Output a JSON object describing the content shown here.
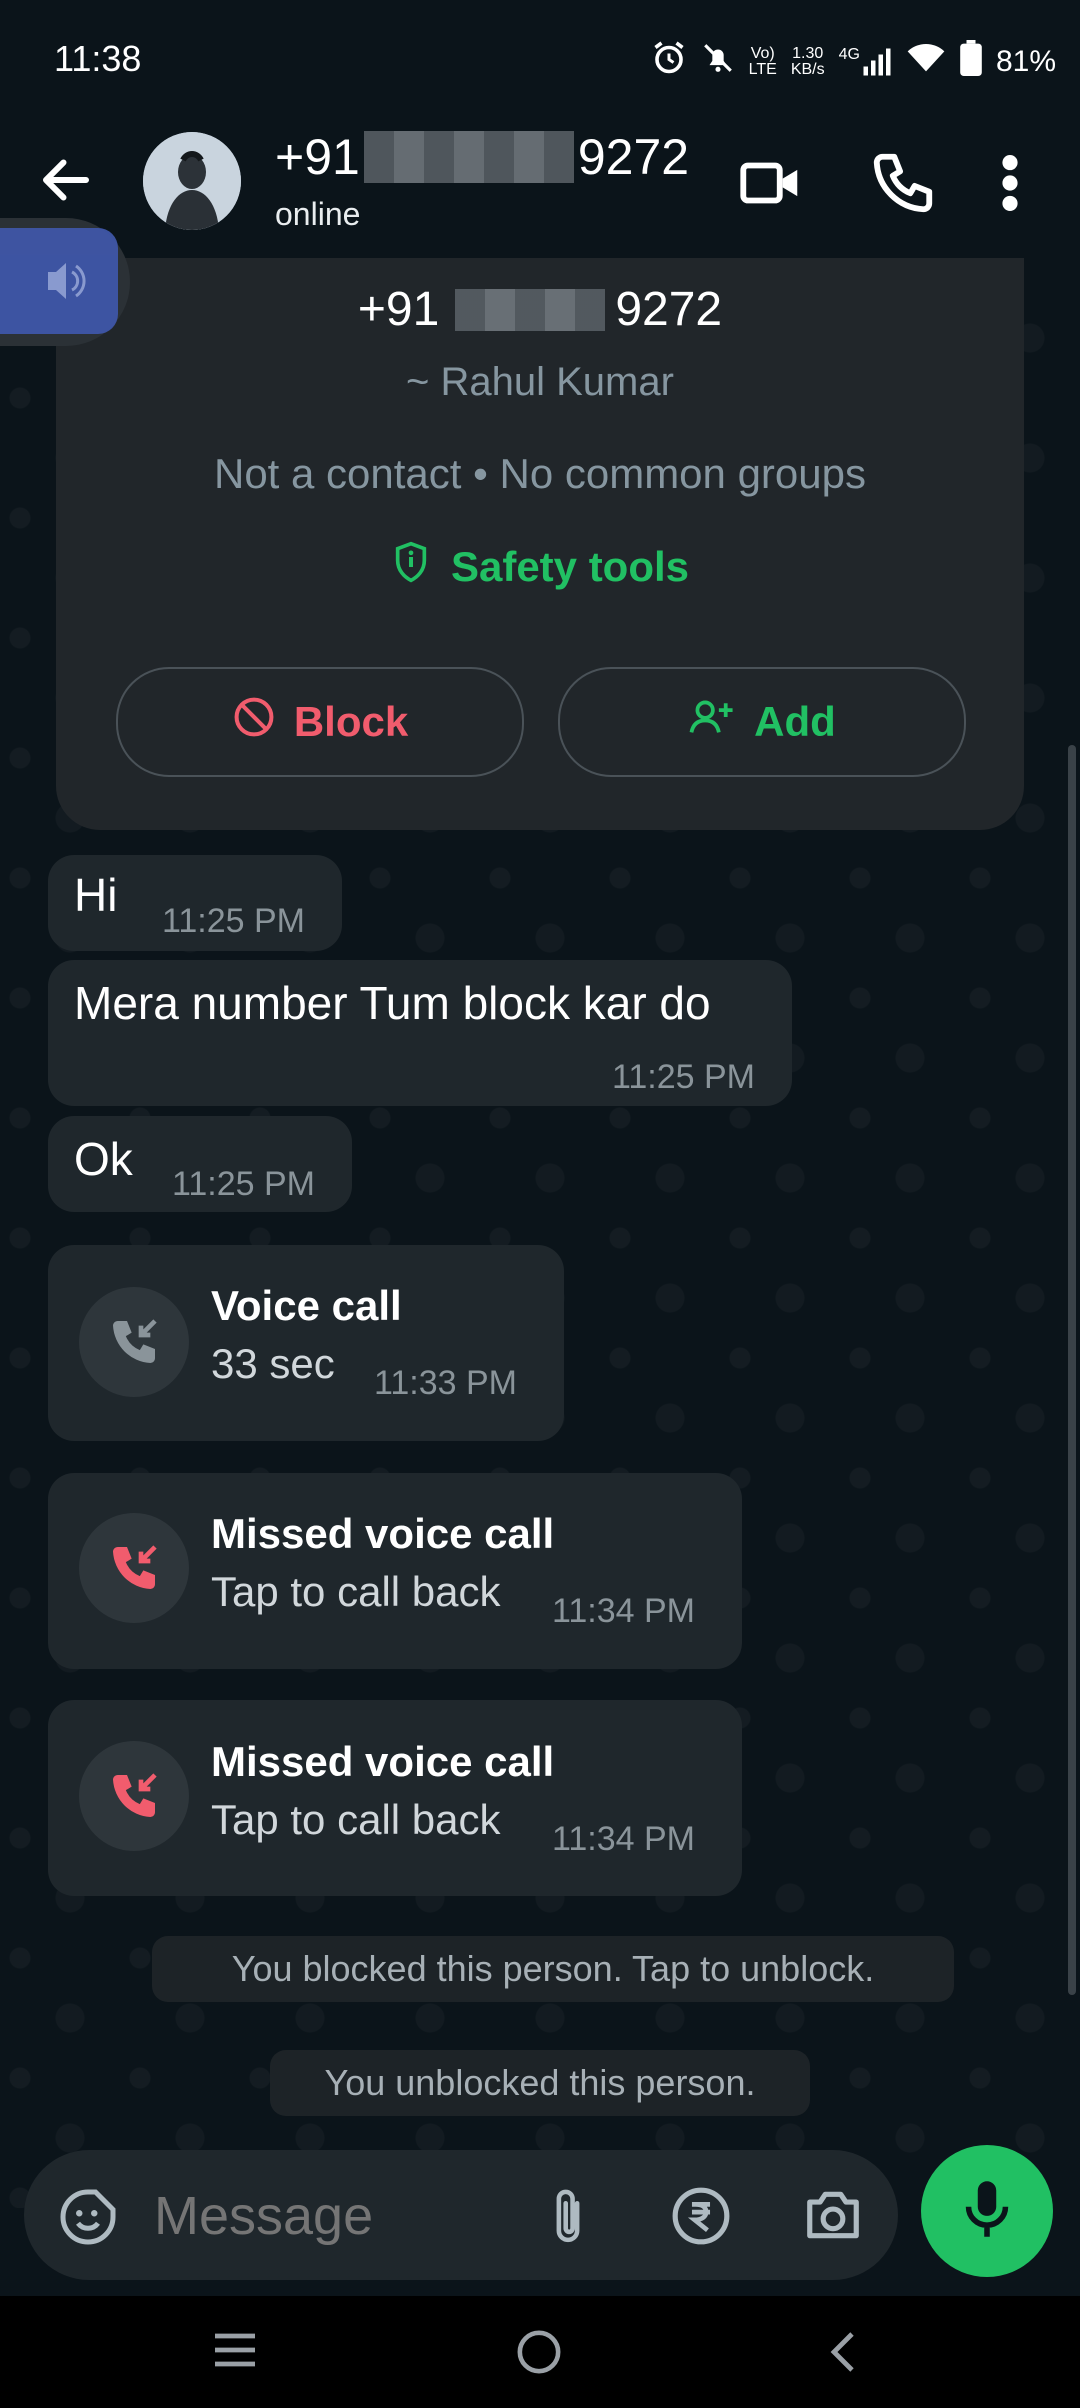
{
  "status_bar": {
    "time": "11:38",
    "net_speed": "1.30",
    "net_speed_unit": "KB/s",
    "volte": "Vo)",
    "lte": "LTE",
    "network": "4G",
    "battery": "81%"
  },
  "header": {
    "name_prefix": "+91",
    "name_suffix": "9272",
    "status": "online"
  },
  "card": {
    "number_prefix": "+91",
    "number_suffix": "9272",
    "display_name": "~ Rahul Kumar",
    "info": "Not a contact • No common groups",
    "safety_tools": "Safety tools",
    "block_label": "Block",
    "add_label": "Add"
  },
  "messages": [
    {
      "text": "Hi",
      "time": "11:25 PM"
    },
    {
      "text": "Mera number Tum block kar do",
      "time": "11:25 PM"
    },
    {
      "text": "Ok",
      "time": "11:25 PM"
    }
  ],
  "calls": [
    {
      "title": "Voice call",
      "subtitle": "33 sec",
      "time": "11:33 PM"
    },
    {
      "title": "Missed voice call",
      "subtitle": "Tap to call back",
      "time": "11:34 PM"
    },
    {
      "title": "Missed voice call",
      "subtitle": "Tap to call back",
      "time": "11:34 PM"
    }
  ],
  "system": {
    "blocked": "You blocked this person. Tap to unblock.",
    "unblocked": "You unblocked this person."
  },
  "composer": {
    "placeholder": "Message"
  },
  "colors": {
    "accent_green": "#21c063",
    "block_red": "#f15c6d",
    "missed_red": "#f15c6d"
  }
}
